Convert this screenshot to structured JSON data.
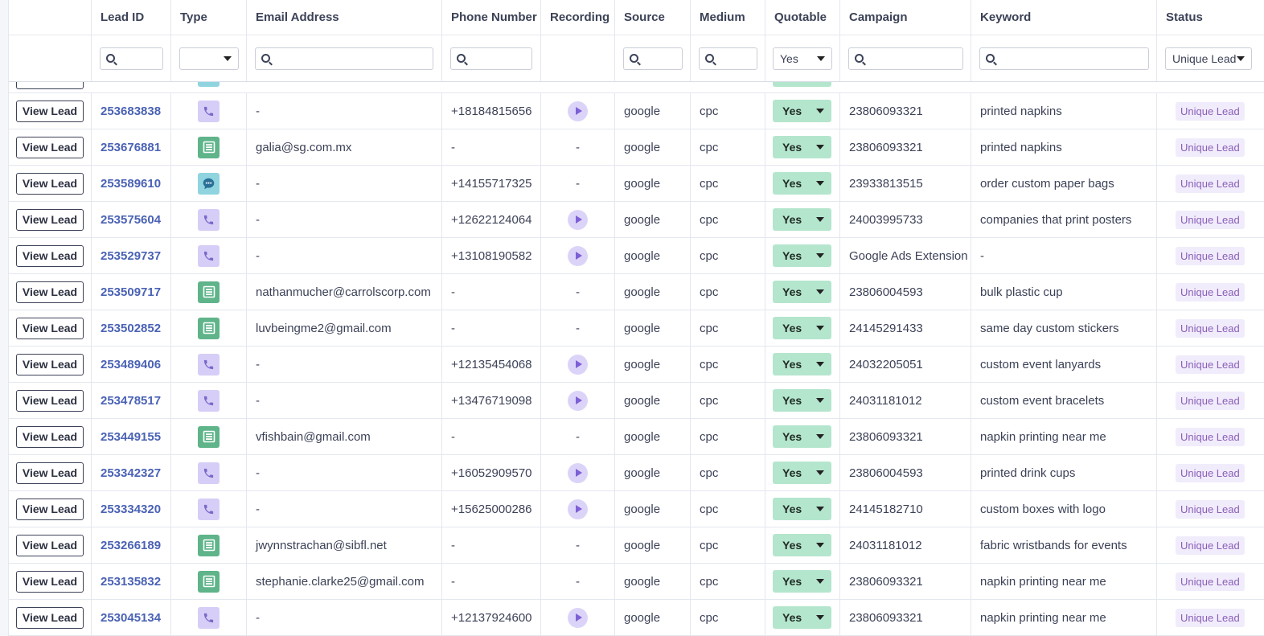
{
  "columns": {
    "lead_id": "Lead ID",
    "type": "Type",
    "email": "Email Address",
    "phone": "Phone Number",
    "recording": "Recording",
    "source": "Source",
    "medium": "Medium",
    "quotable": "Quotable",
    "campaign": "Campaign",
    "keyword": "Keyword",
    "status": "Status"
  },
  "filters": {
    "quotable_value": "Yes",
    "status_value": "Unique Lead"
  },
  "view_lead_label": "View Lead",
  "type_icons": {
    "call": "phone-icon",
    "form": "form-icon",
    "chat": "chat-icon"
  },
  "colors": {
    "lead_link": "#4a62b5",
    "quotable_bg": "#b4e6cd",
    "call_bg": "#d6cef7",
    "form_bg": "#5fb48a",
    "chat_bg": "#8fd4df",
    "badge_text": "#8a5fb8"
  },
  "rows": [
    {
      "id": "253683838",
      "type": "call",
      "email": "-",
      "phone": "+18184815656",
      "recording": true,
      "source": "google",
      "medium": "cpc",
      "quotable": "Yes",
      "campaign": "23806093321",
      "keyword": "printed napkins",
      "status": "Unique Lead"
    },
    {
      "id": "253676881",
      "type": "form",
      "email": "galia@sg.com.mx",
      "phone": "-",
      "recording": false,
      "source": "google",
      "medium": "cpc",
      "quotable": "Yes",
      "campaign": "23806093321",
      "keyword": "printed napkins",
      "status": "Unique Lead"
    },
    {
      "id": "253589610",
      "type": "chat",
      "email": "-",
      "phone": "+14155717325",
      "recording": false,
      "source": "google",
      "medium": "cpc",
      "quotable": "Yes",
      "campaign": "23933813515",
      "keyword": "order custom paper bags",
      "status": "Unique Lead"
    },
    {
      "id": "253575604",
      "type": "call",
      "email": "-",
      "phone": "+12622124064",
      "recording": true,
      "source": "google",
      "medium": "cpc",
      "quotable": "Yes",
      "campaign": "24003995733",
      "keyword": "companies that print posters",
      "status": "Unique Lead"
    },
    {
      "id": "253529737",
      "type": "call",
      "email": "-",
      "phone": "+13108190582",
      "recording": true,
      "source": "google",
      "medium": "cpc",
      "quotable": "Yes",
      "campaign": "Google Ads Extension",
      "keyword": "-",
      "status": "Unique Lead"
    },
    {
      "id": "253509717",
      "type": "form",
      "email": "nathanmucher@carrolscorp.com",
      "phone": "-",
      "recording": false,
      "source": "google",
      "medium": "cpc",
      "quotable": "Yes",
      "campaign": "23806004593",
      "keyword": "bulk plastic cup",
      "status": "Unique Lead"
    },
    {
      "id": "253502852",
      "type": "form",
      "email": "luvbeingme2@gmail.com",
      "phone": "-",
      "recording": false,
      "source": "google",
      "medium": "cpc",
      "quotable": "Yes",
      "campaign": "24145291433",
      "keyword": "same day custom stickers",
      "status": "Unique Lead"
    },
    {
      "id": "253489406",
      "type": "call",
      "email": "-",
      "phone": "+12135454068",
      "recording": true,
      "source": "google",
      "medium": "cpc",
      "quotable": "Yes",
      "campaign": "24032205051",
      "keyword": "custom event lanyards",
      "status": "Unique Lead"
    },
    {
      "id": "253478517",
      "type": "call",
      "email": "-",
      "phone": "+13476719098",
      "recording": true,
      "source": "google",
      "medium": "cpc",
      "quotable": "Yes",
      "campaign": "24031181012",
      "keyword": "custom event bracelets",
      "status": "Unique Lead"
    },
    {
      "id": "253449155",
      "type": "form",
      "email": "vfishbain@gmail.com",
      "phone": "-",
      "recording": false,
      "source": "google",
      "medium": "cpc",
      "quotable": "Yes",
      "campaign": "23806093321",
      "keyword": "napkin printing near me",
      "status": "Unique Lead"
    },
    {
      "id": "253342327",
      "type": "call",
      "email": "-",
      "phone": "+16052909570",
      "recording": true,
      "source": "google",
      "medium": "cpc",
      "quotable": "Yes",
      "campaign": "23806004593",
      "keyword": "printed drink cups",
      "status": "Unique Lead"
    },
    {
      "id": "253334320",
      "type": "call",
      "email": "-",
      "phone": "+15625000286",
      "recording": true,
      "source": "google",
      "medium": "cpc",
      "quotable": "Yes",
      "campaign": "24145182710",
      "keyword": "custom boxes with logo",
      "status": "Unique Lead"
    },
    {
      "id": "253266189",
      "type": "form",
      "email": "jwynnstrachan@sibfl.net",
      "phone": "-",
      "recording": false,
      "source": "google",
      "medium": "cpc",
      "quotable": "Yes",
      "campaign": "24031181012",
      "keyword": "fabric wristbands for events",
      "status": "Unique Lead"
    },
    {
      "id": "253135832",
      "type": "form",
      "email": "stephanie.clarke25@gmail.com",
      "phone": "-",
      "recording": false,
      "source": "google",
      "medium": "cpc",
      "quotable": "Yes",
      "campaign": "23806093321",
      "keyword": "napkin printing near me",
      "status": "Unique Lead"
    },
    {
      "id": "253045134",
      "type": "call",
      "email": "-",
      "phone": "+12137924600",
      "recording": true,
      "source": "google",
      "medium": "cpc",
      "quotable": "Yes",
      "campaign": "23806093321",
      "keyword": "napkin printing near me",
      "status": "Unique Lead"
    }
  ]
}
